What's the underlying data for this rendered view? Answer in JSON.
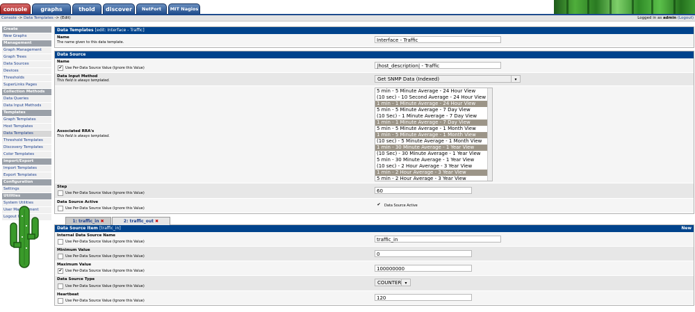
{
  "top_tabs": [
    {
      "label": "console",
      "active": true
    },
    {
      "label": "graphs",
      "active": false
    },
    {
      "label": "thold",
      "active": false
    },
    {
      "label": "discover",
      "active": false
    },
    {
      "label": "NetFort",
      "active": false
    },
    {
      "label": "MIT Nagios",
      "active": false
    }
  ],
  "breadcrumb": {
    "console": "Console",
    "sep1": " -> ",
    "templates": "Data Templates",
    "sep2": " -> ",
    "current": "(Edit)"
  },
  "login": {
    "prefix": "Logged in as ",
    "user": "admin",
    "logout": "(Logout)"
  },
  "sidebar": [
    {
      "type": "head",
      "label": "Create"
    },
    {
      "type": "item",
      "label": "New Graphs"
    },
    {
      "type": "head",
      "label": "Management"
    },
    {
      "type": "item",
      "label": "Graph Management"
    },
    {
      "type": "item",
      "label": "Graph Trees"
    },
    {
      "type": "item",
      "label": "Data Sources"
    },
    {
      "type": "item",
      "label": "Devices"
    },
    {
      "type": "item",
      "label": "Thresholds"
    },
    {
      "type": "item",
      "label": "SuperLinks Pages"
    },
    {
      "type": "head",
      "label": "Collection Methods"
    },
    {
      "type": "item",
      "label": "Data Queries"
    },
    {
      "type": "item",
      "label": "Data Input Methods"
    },
    {
      "type": "head",
      "label": "Templates"
    },
    {
      "type": "item",
      "label": "Graph Templates"
    },
    {
      "type": "item",
      "label": "Host Templates"
    },
    {
      "type": "item",
      "label": "Data Templates",
      "active": true
    },
    {
      "type": "item",
      "label": "Threshold Templates"
    },
    {
      "type": "item",
      "label": "Discovery Templates"
    },
    {
      "type": "item",
      "label": "Color Templates"
    },
    {
      "type": "head",
      "label": "Import/Export"
    },
    {
      "type": "item",
      "label": "Import Templates"
    },
    {
      "type": "item",
      "label": "Export Templates"
    },
    {
      "type": "head",
      "label": "Configuration"
    },
    {
      "type": "item",
      "label": "Settings"
    },
    {
      "type": "head",
      "label": "Utilities"
    },
    {
      "type": "item",
      "label": "System Utilities"
    },
    {
      "type": "item",
      "label": "User Management"
    },
    {
      "type": "item",
      "label": "Logout User"
    }
  ],
  "data_templates": {
    "title": "Data Templates",
    "subtitle": "[edit: Interface - Traffic]",
    "name_label": "Name",
    "name_desc": "The name given to this data template.",
    "name_value": "Interface - Traffic"
  },
  "data_source": {
    "title": "Data Source",
    "name_label": "Name",
    "per_ds": "Use Per-Data Source Value (Ignore this Value)",
    "name_value": "|host_description| - Traffic",
    "input_label": "Data Input Method",
    "templated_desc": "This field is always templated.",
    "input_value": "Get SNMP Data (Indexed)",
    "rra_label": "Associated RRA's",
    "rra_desc": "This field is always templated.",
    "rra_options": [
      {
        "label": "5 min - 5 Minute Average - 24 Hour View",
        "selected": false
      },
      {
        "label": "(10 sec) - 10 Second Average - 24 Hour View",
        "selected": false
      },
      {
        "label": "1 min - 1 Minute Average - 24 Hour View",
        "selected": true
      },
      {
        "label": "5 min - 5 Minute Average - 7 Day View",
        "selected": false
      },
      {
        "label": "(10 Sec) - 1 Minute Average - 7 Day View",
        "selected": false
      },
      {
        "label": "1 min - 1 Minute Average - 7 Day View",
        "selected": true
      },
      {
        "label": "5 min - 5 Minute Average - 1 Month View",
        "selected": false
      },
      {
        "label": "1 min - 5 Minute Average - 1 Month View",
        "selected": true
      },
      {
        "label": "(10 sec) - 5 Minute Average - 1 Month View",
        "selected": false
      },
      {
        "label": "1 min - 30 Minute Average - 1 Year View",
        "selected": true
      },
      {
        "label": "(10 Sec) - 30 Minute Average - 1 Year View",
        "selected": false
      },
      {
        "label": "5 min - 30 Minute Average - 1 Year View",
        "selected": false
      },
      {
        "label": "(10 sec) - 2 Hour Average - 3 Year View",
        "selected": false
      },
      {
        "label": "1 min - 2 Hour Average - 3 Year View",
        "selected": true
      },
      {
        "label": "5 min - 2 Hour Average - 3 Year View",
        "selected": false
      }
    ],
    "step_label": "Step",
    "step_value": "60",
    "active_label": "Data Source Active",
    "active_check_label": "Data Source Active"
  },
  "item_tabs": [
    {
      "label": "1: traffic_in",
      "x": "✖"
    },
    {
      "label": "2: traffic_out",
      "x": "✖"
    }
  ],
  "ds_item": {
    "title": "Data Source Item",
    "subtitle": "[traffic_in]",
    "new_link": "New",
    "internal_label": "Internal Data Source Name",
    "internal_value": "traffic_in",
    "min_label": "Minimum Value",
    "min_value": "0",
    "max_label": "Maximum Value",
    "max_value": "100000000",
    "type_label": "Data Source Type",
    "type_value": "COUNTER",
    "heartbeat_label": "Heartbeat",
    "heartbeat_value": "120",
    "per_ds": "Use Per-Data Source Value (Ignore this Value)"
  }
}
